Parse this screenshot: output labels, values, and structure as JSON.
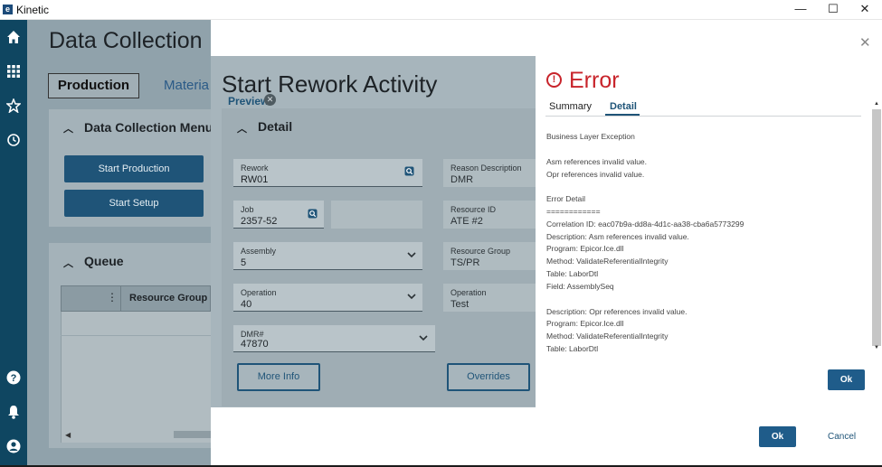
{
  "window": {
    "title": "Kinetic",
    "logo_letter": "e",
    "minimize": "—",
    "maximize": "☐",
    "close": "✕"
  },
  "rail": {
    "icons": [
      "home-icon",
      "apps-icon",
      "star-icon",
      "history-icon",
      "help-icon",
      "bell-icon",
      "user-icon"
    ]
  },
  "background": {
    "title": "Data Collection",
    "tabs": {
      "production": "Production",
      "material": "Materia"
    },
    "menu_panel": {
      "header": "Data Collection Menu",
      "buttons": {
        "start_production": "Start Production",
        "start_setup": "Start Setup"
      }
    },
    "queue_panel": {
      "header": "Queue",
      "column": "Resource Group ID",
      "dots": "⋮"
    }
  },
  "rework": {
    "title": "Start Rework Activity",
    "preview": "Preview",
    "detail_header": "Detail",
    "fields": {
      "rework": {
        "label": "Rework",
        "value": "RW01"
      },
      "job": {
        "label": "Job",
        "value": "2357-52"
      },
      "assembly": {
        "label": "Assembly",
        "value": "5"
      },
      "operation": {
        "label": "Operation",
        "value": "40"
      },
      "dmr": {
        "label": "DMR#",
        "value": "47870"
      },
      "reason_description": {
        "label": "Reason Description",
        "value": "DMR"
      },
      "resource_id": {
        "label": "Resource ID",
        "value": "ATE #2"
      },
      "resource_group": {
        "label": "Resource Group",
        "value": "TS/PR"
      },
      "operation_desc": {
        "label": "Operation",
        "value": "Test"
      }
    },
    "buttons": {
      "more_info": "More Info",
      "overrides": "Overrides"
    }
  },
  "error": {
    "title": "Error",
    "tabs": {
      "summary": "Summary",
      "detail": "Detail"
    },
    "lines": [
      "Business Layer Exception",
      "",
      "Asm references invalid value.",
      "Opr references invalid value.",
      "",
      "Error Detail",
      "============",
      "Correlation ID: eac07b9a-dd8a-4d1c-aa38-cba6a5773299",
      "Description: Asm references invalid value.",
      "Program: Epicor.Ice.dll",
      "Method: ValidateReferentialIntegrity",
      "Table: LaborDtl",
      "Field: AssemblySeq",
      "",
      "Description: Opr references invalid value.",
      "Program: Epicor.Ice.dll",
      "Method: ValidateReferentialIntegrity",
      "Table: LaborDtl"
    ],
    "ok": "Ok"
  },
  "footer": {
    "ok": "Ok",
    "cancel": "Cancel"
  },
  "colors": {
    "rail": "#0f4661",
    "primary": "#1f5c8a",
    "error": "#c8242b"
  }
}
